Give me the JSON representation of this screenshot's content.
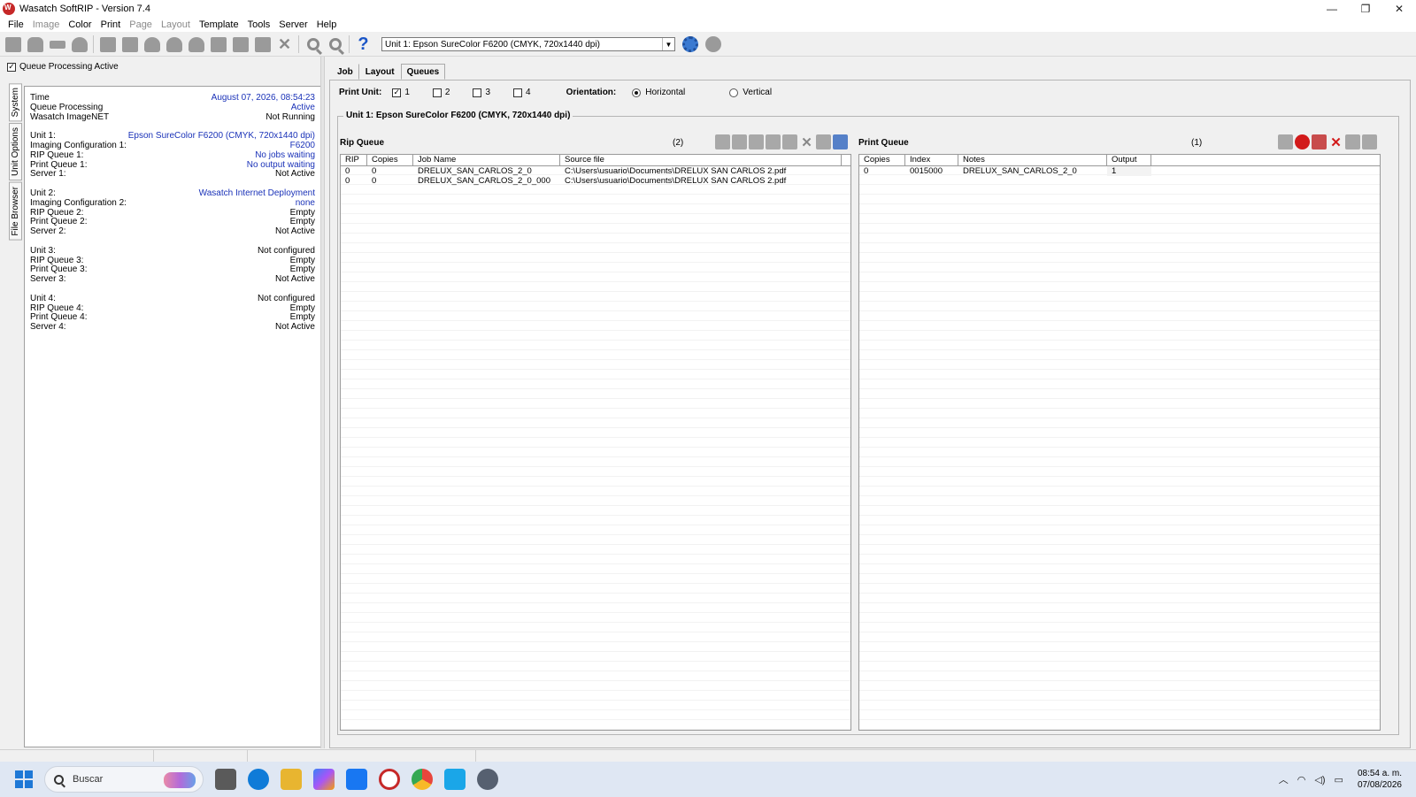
{
  "window": {
    "title": "Wasatch SoftRIP - Version 7.4",
    "controls": [
      "—",
      "❐",
      "✕"
    ]
  },
  "menu": [
    {
      "label": "File",
      "enabled": true
    },
    {
      "label": "Image",
      "enabled": false
    },
    {
      "label": "Color",
      "enabled": true
    },
    {
      "label": "Print",
      "enabled": true
    },
    {
      "label": "Page",
      "enabled": false
    },
    {
      "label": "Layout",
      "enabled": false
    },
    {
      "label": "Template",
      "enabled": true
    },
    {
      "label": "Tools",
      "enabled": true
    },
    {
      "label": "Server",
      "enabled": true
    },
    {
      "label": "Help",
      "enabled": true
    }
  ],
  "toolbar": {
    "unit_select_value": "Unit 1: Epson  SureColor F6200  (CMYK, 720x1440 dpi)",
    "help_glyph": "?"
  },
  "left": {
    "queue_processing_label": "Queue Processing Active",
    "queue_processing_checked": true,
    "vertical_tabs": [
      "System",
      "Unit Options",
      "File Browser"
    ],
    "status": {
      "time_label": "Time",
      "time_value": "August 07, 2026,  08:54:23",
      "qp_label": "Queue Processing",
      "qp_value": "Active",
      "imagenet_label": "Wasatch ImageNET",
      "imagenet_value": "Not Running",
      "units": [
        {
          "unit_label": "Unit 1:",
          "unit_value": "Epson  SureColor F6200  (CMYK, 720x1440 dpi)",
          "unit_blue": true,
          "ic_label": "Imaging Configuration 1:",
          "ic_value": "F6200",
          "ic_blue": true,
          "rq_label": "RIP Queue 1:",
          "rq_value": "No jobs waiting",
          "rq_blue": true,
          "pq_label": "Print Queue 1:",
          "pq_value": "No output waiting",
          "pq_blue": true,
          "sv_label": "Server 1:",
          "sv_value": "Not Active"
        },
        {
          "unit_label": "Unit 2:",
          "unit_value": "Wasatch  Internet  Deployment",
          "unit_blue": true,
          "ic_label": "Imaging Configuration 2:",
          "ic_value": "none",
          "ic_blue": true,
          "rq_label": "RIP Queue 2:",
          "rq_value": "Empty",
          "pq_label": "Print Queue 2:",
          "pq_value": "Empty",
          "sv_label": "Server 2:",
          "sv_value": "Not Active"
        },
        {
          "unit_label": "Unit 3:",
          "unit_value": "Not configured",
          "rq_label": "RIP Queue 3:",
          "rq_value": "Empty",
          "pq_label": "Print Queue 3:",
          "pq_value": "Empty",
          "sv_label": "Server 3:",
          "sv_value": "Not Active"
        },
        {
          "unit_label": "Unit 4:",
          "unit_value": "Not configured",
          "rq_label": "RIP Queue 4:",
          "rq_value": "Empty",
          "pq_label": "Print Queue 4:",
          "pq_value": "Empty",
          "sv_label": "Server 4:",
          "sv_value": "Not Active"
        }
      ]
    }
  },
  "tabs": [
    "Job",
    "Layout",
    "Queues"
  ],
  "active_tab": "Queues",
  "print_unit": {
    "label": "Print Unit:",
    "options": [
      {
        "label": "1",
        "checked": true
      },
      {
        "label": "2",
        "checked": false
      },
      {
        "label": "3",
        "checked": false
      },
      {
        "label": "4",
        "checked": false
      }
    ]
  },
  "orientation": {
    "label": "Orientation:",
    "horizontal_label": "Horizontal",
    "vertical_label": "Vertical",
    "selected": "Horizontal"
  },
  "group_title": "Unit  1:  Epson  SureColor F6200  (CMYK,  720x1440 dpi)",
  "rip_queue": {
    "title": "Rip Queue",
    "count": "(2)",
    "columns": [
      "RIP",
      "Copies",
      "Job Name",
      "Source file"
    ],
    "rows": [
      [
        "0",
        "0",
        "DRELUX_SAN_CARLOS_2_0",
        "C:\\Users\\usuario\\Documents\\DRELUX SAN CARLOS 2.pdf"
      ],
      [
        "0",
        "0",
        "DRELUX_SAN_CARLOS_2_0_000",
        "C:\\Users\\usuario\\Documents\\DRELUX SAN CARLOS 2.pdf"
      ]
    ]
  },
  "print_queue": {
    "title": "Print Queue",
    "count": "(1)",
    "columns": [
      "Copies",
      "Index",
      "Notes",
      "Output"
    ],
    "rows": [
      [
        "0",
        "0015000",
        "DRELUX_SAN_CARLOS_2_0",
        "1"
      ]
    ]
  },
  "taskbar": {
    "search_placeholder": "Buscar",
    "time": "08:54 a. m.",
    "date": "07/08/2026",
    "tray_icons": [
      "^",
      "wifi",
      "vol",
      "msg"
    ],
    "app_colors": [
      "#5a5a5a",
      "#0f7bd8",
      "#e8b530",
      "#8b5cf6",
      "#1877f2",
      "#c62828",
      "#e8453c",
      "#1aa6e8",
      "#566070"
    ]
  }
}
